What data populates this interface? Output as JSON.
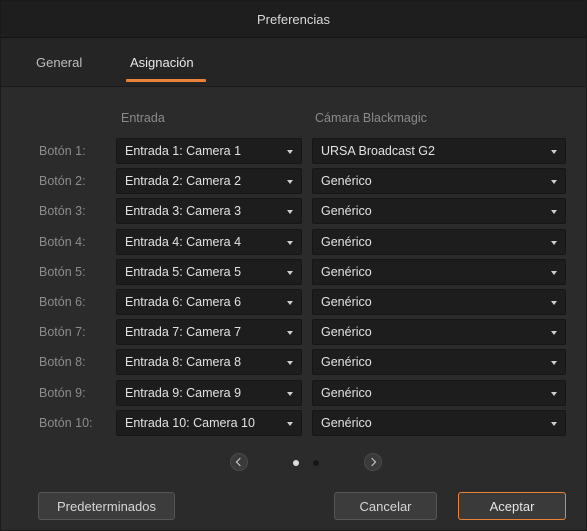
{
  "window": {
    "title": "Preferencias"
  },
  "tabs": [
    {
      "label": "General",
      "selected": false
    },
    {
      "label": "Asignación",
      "selected": true
    }
  ],
  "columns": {
    "input": "Entrada",
    "camera": "Cámara Blackmagic"
  },
  "rows": [
    {
      "label": "Botón 1:",
      "input": "Entrada 1: Camera 1",
      "camera": "URSA Broadcast G2"
    },
    {
      "label": "Botón 2:",
      "input": "Entrada 2: Camera 2",
      "camera": "Genérico"
    },
    {
      "label": "Botón 3:",
      "input": "Entrada 3: Camera 3",
      "camera": "Genérico"
    },
    {
      "label": "Botón 4:",
      "input": "Entrada 4: Camera 4",
      "camera": "Genérico"
    },
    {
      "label": "Botón 5:",
      "input": "Entrada 5: Camera 5",
      "camera": "Genérico"
    },
    {
      "label": "Botón 6:",
      "input": "Entrada 6: Camera 6",
      "camera": "Genérico"
    },
    {
      "label": "Botón 7:",
      "input": "Entrada 7: Camera 7",
      "camera": "Genérico"
    },
    {
      "label": "Botón 8:",
      "input": "Entrada 8: Camera 8",
      "camera": "Genérico"
    },
    {
      "label": "Botón 9:",
      "input": "Entrada 9: Camera 9",
      "camera": "Genérico"
    },
    {
      "label": "Botón 10:",
      "input": "Entrada 10: Camera 10",
      "camera": "Genérico"
    }
  ],
  "pager": {
    "current_page": 1,
    "total_pages": 2
  },
  "buttons": {
    "defaults": "Predeterminados",
    "cancel": "Cancelar",
    "accept": "Aceptar"
  },
  "colors": {
    "accent": "#e9823a",
    "background": "#2b2b2b",
    "dropdown": "#1d1d1d"
  }
}
